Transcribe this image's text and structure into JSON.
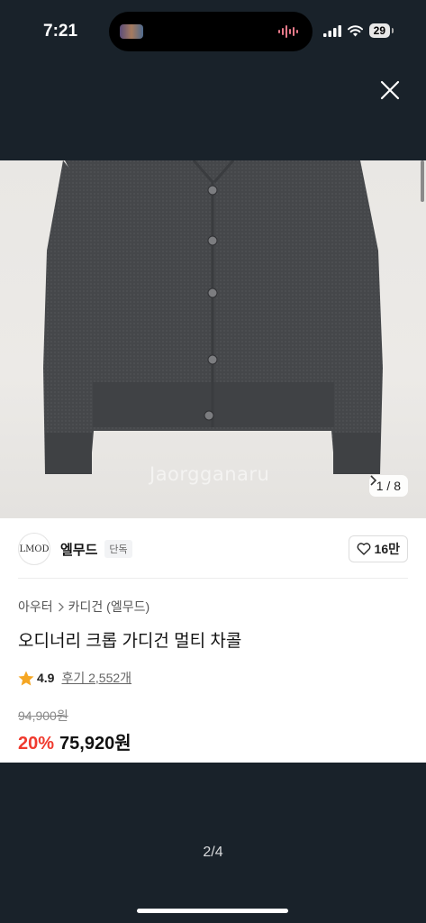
{
  "status_bar": {
    "time": "7:21",
    "battery": "29",
    "icons": [
      "signal-icon",
      "wifi-icon",
      "battery-icon"
    ]
  },
  "viewer": {
    "close_icon": "close-icon",
    "page_indicator": "2/4"
  },
  "product": {
    "image_pager": "1 / 8",
    "watermark": "Jaorgganaru",
    "brand": {
      "logo_text": "LMOD",
      "name": "엘무드",
      "badge": "단독"
    },
    "likes": "16만",
    "breadcrumb": [
      "아우터",
      "카디건 (엘무드)"
    ],
    "title": "오디너리 크롭 가디건 멀티 차콜",
    "rating": "4.9",
    "reviews": "후기 2,552개",
    "original_price": "94,900원",
    "discount": "20%",
    "sale_price": "75,920원"
  },
  "colors": {
    "backdrop": "#19222a",
    "discount": "#f03a2e",
    "star": "#f5a623"
  }
}
